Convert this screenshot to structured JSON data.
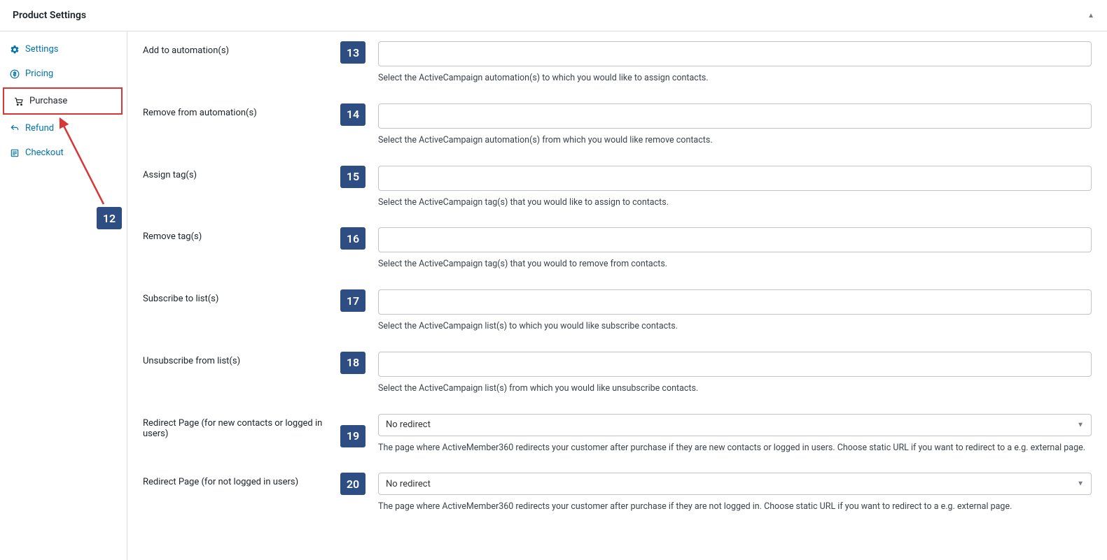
{
  "header": {
    "title": "Product Settings"
  },
  "sidebar": {
    "items": [
      {
        "label": "Settings",
        "icon": "gear-icon",
        "active": false
      },
      {
        "label": "Pricing",
        "icon": "dollar-icon",
        "active": false
      },
      {
        "label": "Purchase",
        "icon": "cart-icon",
        "active": true
      },
      {
        "label": "Refund",
        "icon": "return-icon",
        "active": false
      },
      {
        "label": "Checkout",
        "icon": "list-icon",
        "active": false
      }
    ]
  },
  "annotation": {
    "sidebar_num": "12"
  },
  "fields": [
    {
      "label": "Add to automation(s)",
      "num": "13",
      "type": "text",
      "value": "",
      "help": "Select the ActiveCampaign automation(s) to which you would like to assign contacts."
    },
    {
      "label": "Remove from automation(s)",
      "num": "14",
      "type": "text",
      "value": "",
      "help": "Select the ActiveCampaign automation(s) from which you would like remove contacts."
    },
    {
      "label": "Assign tag(s)",
      "num": "15",
      "type": "text",
      "value": "",
      "help": "Select the ActiveCampaign tag(s) that you would like to assign to contacts."
    },
    {
      "label": "Remove tag(s)",
      "num": "16",
      "type": "text",
      "value": "",
      "help": "Select the ActiveCampaign tag(s) that you would to remove from contacts."
    },
    {
      "label": "Subscribe to list(s)",
      "num": "17",
      "type": "text",
      "value": "",
      "help": "Select the ActiveCampaign list(s) to which you would like subscribe contacts."
    },
    {
      "label": "Unsubscribe from list(s)",
      "num": "18",
      "type": "text",
      "value": "",
      "help": "Select the ActiveCampaign list(s) from which you would like unsubscribe contacts."
    },
    {
      "label": "Redirect Page (for new contacts or logged in users)",
      "num": "19",
      "type": "select",
      "value": "No redirect",
      "help": "The page where ActiveMember360 redirects your customer after purchase if they are new contacts or logged in users. Choose static URL if you want to redirect to a e.g. external page.",
      "num_offset": true
    },
    {
      "label": "Redirect Page (for not logged in users)",
      "num": "20",
      "type": "select",
      "value": "No redirect",
      "help": "The page where ActiveMember360 redirects your customer after purchase if they are not logged in. Choose static URL if you want to redirect to a e.g. external page."
    }
  ]
}
